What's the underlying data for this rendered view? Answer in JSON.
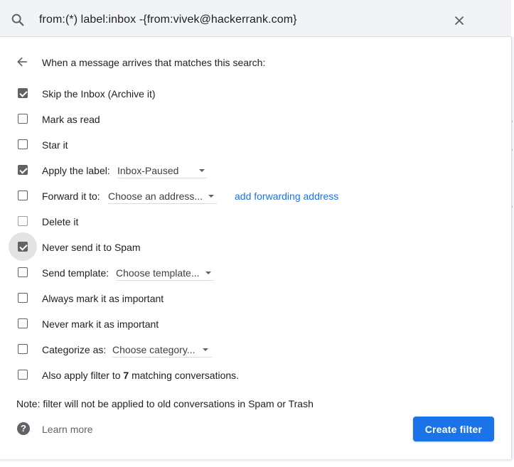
{
  "search": {
    "query": "from:(*) label:inbox -{from:vivek@hackerrank.com}"
  },
  "header": {
    "text": "When a message arrives that matches this search:"
  },
  "actions": {
    "skip_inbox": {
      "label": "Skip the Inbox (Archive it)",
      "checked": true
    },
    "mark_read": {
      "label": "Mark as read",
      "checked": false
    },
    "star": {
      "label": "Star it",
      "checked": false
    },
    "apply_label": {
      "label": "Apply the label:",
      "checked": true,
      "value": "Inbox-Paused"
    },
    "forward": {
      "label": "Forward it to:",
      "checked": false,
      "value": "Choose an address...",
      "link": "add forwarding address"
    },
    "delete": {
      "label": "Delete it",
      "checked": false
    },
    "never_spam": {
      "label": "Never send it to Spam",
      "checked": true
    },
    "send_template": {
      "label": "Send template:",
      "checked": false,
      "value": "Choose template..."
    },
    "always_important": {
      "label": "Always mark it as important",
      "checked": false
    },
    "never_important": {
      "label": "Never mark it as important",
      "checked": false
    },
    "categorize": {
      "label": "Categorize as:",
      "checked": false,
      "value": "Choose category..."
    },
    "also_apply": {
      "label_prefix": "Also apply filter to ",
      "count": "7",
      "label_suffix": " matching conversations.",
      "checked": false
    }
  },
  "footer": {
    "note": "Note: filter will not be applied to old conversations in Spam or Trash",
    "learn_more": "Learn more",
    "create_filter": "Create filter"
  },
  "colors": {
    "accent": "#1a73e8",
    "checkbox": "#5f6368",
    "search_bg": "#f1f3f4"
  },
  "icons": {
    "search": "search-icon",
    "close": "close-icon",
    "back": "back-arrow-icon",
    "help": "help-icon",
    "dropdown": "caret-down-icon"
  }
}
